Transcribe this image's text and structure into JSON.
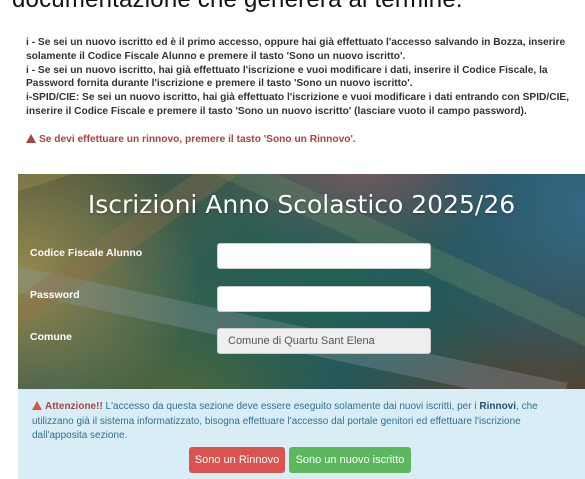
{
  "top_text": "documentazione che genererà al termine.",
  "info": {
    "line1_icon": "i",
    "line1": "- Se sei un nuovo iscritto ed è il primo accesso, oppure hai già effettuato l'accesso salvando in Bozza, inserire solamente il Codice Fiscale Alunno e premere il tasto 'Sono un nuovo iscritto'.",
    "line2_icon": "i",
    "line2": "- Se sei un nuovo iscritto, hai già effettuato l'iscrizione e vuoi modificare i dati, inserire il Codice Fiscale, la Password fornita durante l'iscrizione e premere il tasto 'Sono un nuovo iscritto'.",
    "line3_icon": "i",
    "line3": "-SPID/CIE: Se sei un nuovo iscritto, hai già effettuato l'iscrizione e vuoi modificare i dati entrando con SPID/CIE, inserire il Codice Fiscale e premere il tasto 'Sono un nuovo iscritto' (lasciare vuoto il campo password).",
    "warning": "Se devi effettuare un rinnovo, premere il tasto 'Sono un Rinnovo'."
  },
  "form": {
    "title": "Iscrizioni Anno Scolastico 2025/26",
    "codice_label": "Codice Fiscale Alunno",
    "codice_value": "",
    "password_label": "Password",
    "password_value": "",
    "comune_label": "Comune",
    "comune_value": "Comune di Quartu Sant Elena"
  },
  "attention": {
    "strong": "Attenzione!!",
    "text1": " L'accesso da questa sezione deve essere eseguito solamente dai nuovi iscritti, per i ",
    "strong2": "Rinnovi",
    "text2": ", che utilizzano già il sistema informatizzato, bisogna effettuare l'accesso dal portale genitori ed effettuare l'iscrizione dall'apposita sezione."
  },
  "buttons": {
    "rinnovo": "Sono un Rinnovo",
    "nuovo": "Sono un nuovo iscritto"
  },
  "colors": {
    "danger": "#d9534f",
    "success": "#5cb85c",
    "info_bg": "#d9edf7"
  }
}
